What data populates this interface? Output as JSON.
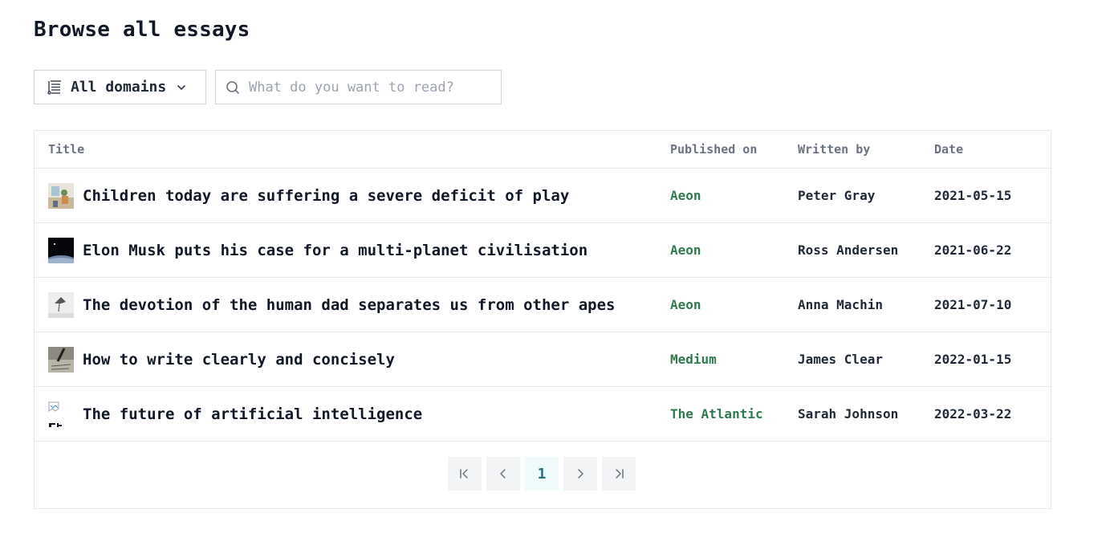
{
  "header": {
    "title": "Browse all essays"
  },
  "filters": {
    "domain_select": {
      "label": "All domains",
      "icon": "list-icon"
    },
    "search": {
      "placeholder": "What do you want to read?",
      "value": ""
    }
  },
  "table": {
    "columns": [
      "Title",
      "Published on",
      "Written by",
      "Date"
    ],
    "rows": [
      {
        "title": "Children today are suffering a severe deficit of play",
        "published_on": "Aeon",
        "written_by": "Peter Gray",
        "date": "2021-05-15"
      },
      {
        "title": "Elon Musk puts his case for a multi-planet civilisation",
        "published_on": "Aeon",
        "written_by": "Ross Andersen",
        "date": "2021-06-22"
      },
      {
        "title": "The devotion of the human dad separates us from other apes",
        "published_on": "Aeon",
        "written_by": "Anna Machin",
        "date": "2021-07-10"
      },
      {
        "title": "How to write clearly and concisely",
        "published_on": "Medium",
        "written_by": "James Clear",
        "date": "2022-01-15"
      },
      {
        "title": "The future of artificial intelligence",
        "published_on": "The Atlantic",
        "written_by": "Sarah Johnson",
        "date": "2022-03-22"
      }
    ]
  },
  "pagination": {
    "current_page": "1",
    "controls": [
      "first-page-icon",
      "previous-page-icon",
      "next-page-icon",
      "last-page-icon"
    ]
  },
  "colors": {
    "publisher_link": "#2f7a4f",
    "current_page": "#2a7282",
    "border": "#e5e7eb"
  }
}
